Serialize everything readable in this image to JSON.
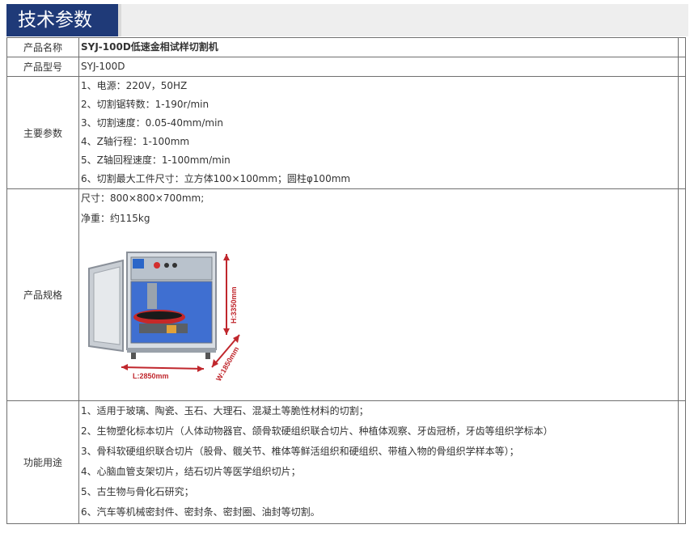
{
  "header": {
    "title": "技术参数"
  },
  "rows": {
    "name": {
      "label": "产品名称",
      "value": "SYJ-100D低速金相试样切割机"
    },
    "model": {
      "label": "产品型号",
      "value": "SYJ-100D"
    },
    "main": {
      "label": "主要参数",
      "lines": [
        "1、电源：220V，50HZ",
        "2、切割锯转数：1-190r/min",
        "3、切割速度：0.05-40mm/min",
        "4、Z轴行程：1-100mm",
        "5、Z轴回程速度：1-100mm/min",
        "6、切割最大工件尺寸：立方体100×100mm；圆柱φ100mm"
      ]
    },
    "spec": {
      "label": "产品规格",
      "size": "尺寸：800×800×700mm;",
      "weight": "净重：约115kg",
      "image": {
        "dim_length": "L:2850mm",
        "dim_width": "W:1850mm",
        "dim_height": "H:3350mm"
      }
    },
    "use": {
      "label": "功能用途",
      "lines": [
        "1、适用于玻璃、陶瓷、玉石、大理石、混凝土等脆性材料的切割；",
        "2、生物塑化标本切片（人体动物器官、颌骨软硬组织联合切片、种植体观察、牙齿冠桥，牙齿等组织学标本）",
        "3、骨科软硬组织联合切片（股骨、髋关节、椎体等鲜活组织和硬组织、带植入物的骨组织学样本等）；",
        "4、心脑血管支架切片，结石切片等医学组织切片；",
        "5、古生物与骨化石研究；",
        "6、汽车等机械密封件、密封条、密封圈、油封等切割。"
      ]
    }
  },
  "colors": {
    "header_bg": "#1f3a78",
    "header_text": "#ffffff",
    "border": "#6f6f6f",
    "dim_red": "#c0272d"
  }
}
